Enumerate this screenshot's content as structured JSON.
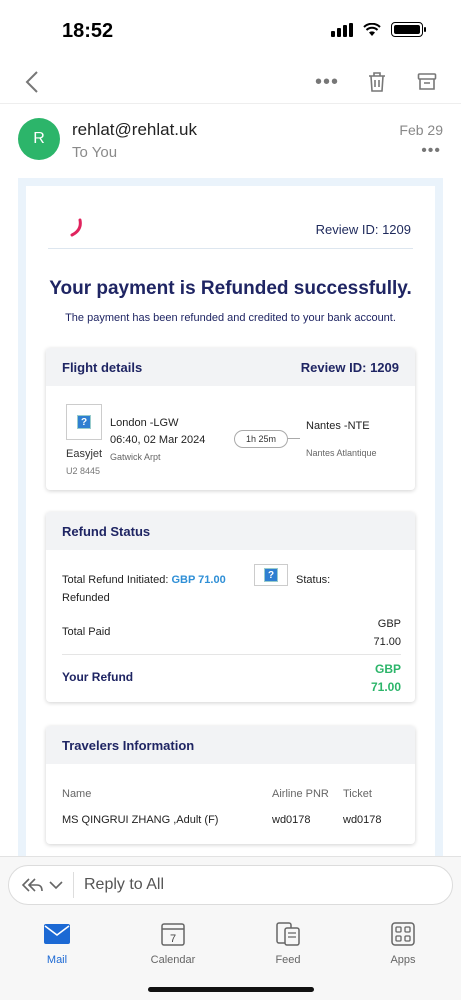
{
  "status_bar": {
    "time": "18:52"
  },
  "toolbar": {
    "more_label": "•••"
  },
  "sender": {
    "avatar_initial": "R",
    "email": "rehlat@rehlat.uk",
    "to": "To You",
    "date": "Feb 29",
    "more_label": "•••"
  },
  "email": {
    "review_id_top": "Review ID: 1209",
    "headline": "Your payment is Refunded successfully.",
    "subline": "The payment has been refunded and credited to your bank account.",
    "flight": {
      "title": "Flight details",
      "review_id": "Review ID: 1209",
      "airline": "Easyjet",
      "flight_no": "U2 8445",
      "from_city": "London -LGW",
      "from_time": "06:40, 02 Mar 2024",
      "from_airport": "Gatwick Arpt",
      "duration": "1h 25m",
      "to_city": "Nantes -NTE",
      "to_airport": "Nantes Atlantique"
    },
    "refund": {
      "title": "Refund Status",
      "initiated_label": "Total Refund Initiated:",
      "initiated_amount": "GBP 71.00",
      "status_label": "Status:",
      "status_value": "Refunded",
      "total_paid_label": "Total Paid",
      "total_paid_currency": "GBP",
      "total_paid_value": "71.00",
      "your_refund_label": "Your Refund",
      "your_refund_currency": "GBP",
      "your_refund_value": "71.00"
    },
    "travelers": {
      "title": "Travelers Information",
      "col_name": "Name",
      "col_pnr": "Airline PNR",
      "col_ticket": "Ticket",
      "name": "MS QINGRUI ZHANG ,Adult (F)",
      "pnr": "wd0178",
      "ticket": "wd0178"
    }
  },
  "reply": {
    "label": "Reply to All"
  },
  "tabs": [
    {
      "label": "Mail",
      "icon": "mail-icon"
    },
    {
      "label": "Calendar",
      "icon": "calendar-icon",
      "day": "7"
    },
    {
      "label": "Feed",
      "icon": "feed-icon"
    },
    {
      "label": "Apps",
      "icon": "apps-icon"
    }
  ],
  "colors": {
    "accent": "#1c69d4",
    "avatar": "#2cb56a",
    "headline": "#1f2563",
    "refund_green": "#2cb56a"
  }
}
